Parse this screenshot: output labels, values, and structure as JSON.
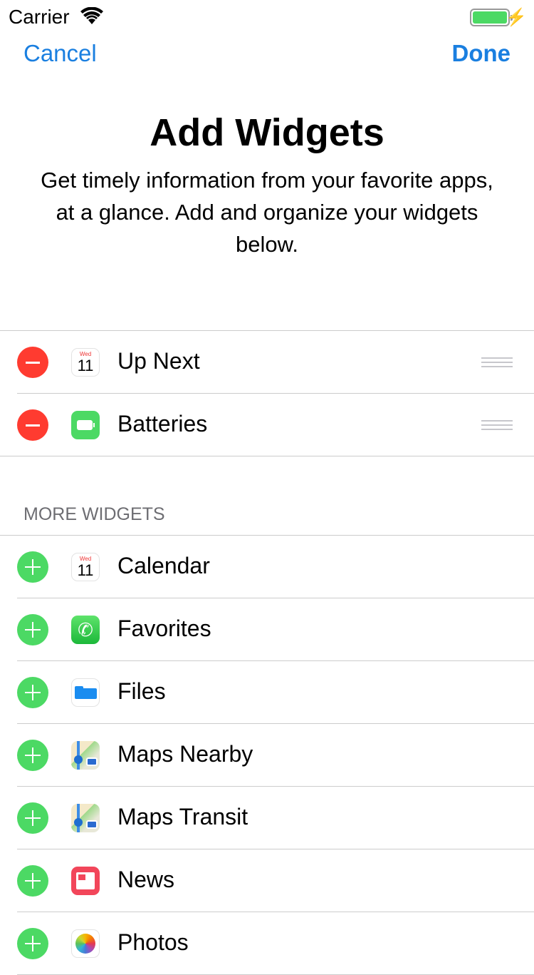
{
  "status": {
    "carrier": "Carrier",
    "battery_level": 1.0,
    "charging": true
  },
  "nav": {
    "cancel": "Cancel",
    "done": "Done"
  },
  "header": {
    "title": "Add Widgets",
    "subtitle": "Get timely information from your favorite apps, at a glance. Add and organize your widgets below."
  },
  "enabled": [
    {
      "label": "Up Next",
      "icon": "calendar-icon",
      "day": "Wed",
      "date": "11"
    },
    {
      "label": "Batteries",
      "icon": "batteries-icon"
    }
  ],
  "more": {
    "heading": "MORE WIDGETS",
    "items": [
      {
        "label": "Calendar",
        "icon": "calendar-icon",
        "day": "Wed",
        "date": "11"
      },
      {
        "label": "Favorites",
        "icon": "phone-icon"
      },
      {
        "label": "Files",
        "icon": "files-icon"
      },
      {
        "label": "Maps Nearby",
        "icon": "maps-icon"
      },
      {
        "label": "Maps Transit",
        "icon": "maps-icon"
      },
      {
        "label": "News",
        "icon": "news-icon"
      },
      {
        "label": "Photos",
        "icon": "photos-icon"
      }
    ]
  },
  "colors": {
    "accent": "#1a7fe0",
    "remove": "#ff3b30",
    "add": "#4cd964"
  }
}
